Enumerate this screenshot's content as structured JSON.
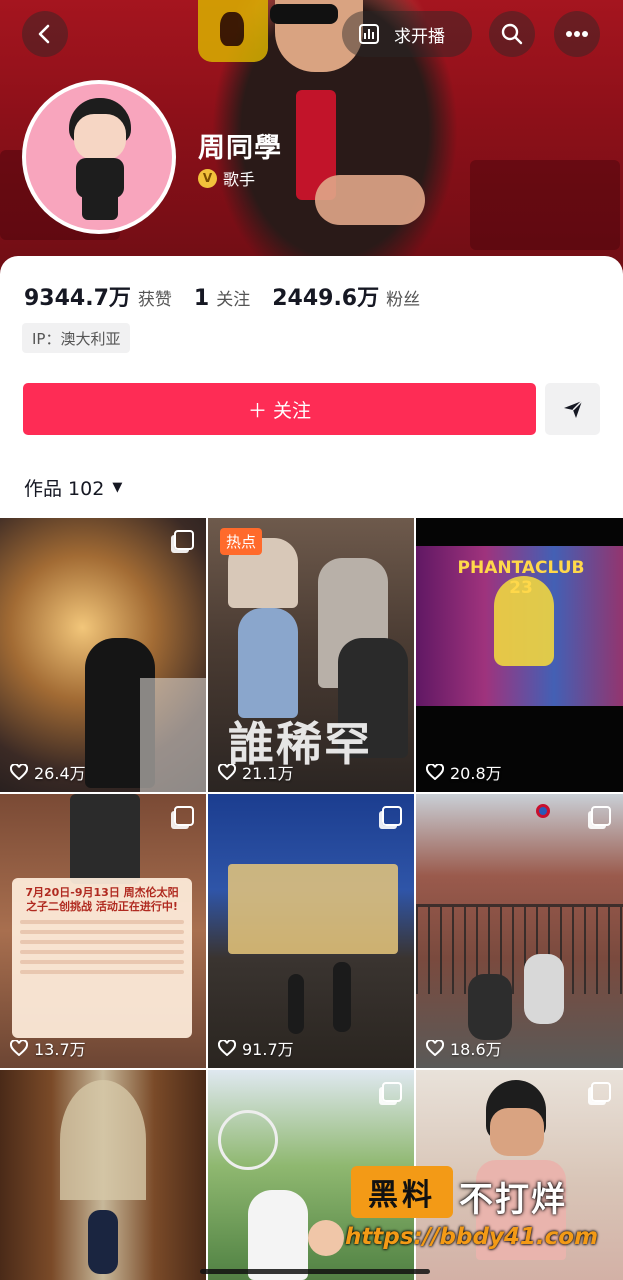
{
  "header": {
    "back_icon": "chevron-left-icon",
    "request_stream_label": "求开播",
    "request_stream_icon": "bar-chart-icon",
    "search_icon": "search-icon",
    "more_icon": "more-dots-icon"
  },
  "profile": {
    "name": "周同學",
    "verified_badge": "V",
    "verified_title": "歌手",
    "stats": {
      "likes_value": "9344.7万",
      "likes_label": "获赞",
      "following_value": "1",
      "following_label": "关注",
      "followers_value": "2449.6万",
      "followers_label": "粉丝"
    },
    "ip_label": "IP：澳大利亚"
  },
  "actions": {
    "follow_label": "＋ 关注",
    "share_icon": "paper-plane-icon"
  },
  "works": {
    "label": "作品 102",
    "caret": "▼"
  },
  "videos": [
    {
      "likes": "26.4万",
      "multi": true
    },
    {
      "likes": "21.1万",
      "hot_tag": "热点",
      "overlay_text": "誰稀罕"
    },
    {
      "likes": "20.8万",
      "overlay_text": "PHANTACLUB 23"
    },
    {
      "likes": "13.7万",
      "multi": true,
      "notice_title": "7月20日-9月13日 周杰伦太阳之子二创挑战 活动正在进行中!"
    },
    {
      "likes": "91.7万",
      "multi": true
    },
    {
      "likes": "18.6万",
      "multi": true
    },
    {
      "likes": "",
      "multi": false
    },
    {
      "likes": "",
      "multi": true
    },
    {
      "likes": "",
      "multi": true
    }
  ],
  "watermark": {
    "badge": "黑料",
    "slogan": "不打烊",
    "url": "https://bbdy41.com"
  },
  "colors": {
    "accent": "#fe2c55",
    "cover_red": "#a5151f",
    "watermark_orange": "#f39a16"
  }
}
